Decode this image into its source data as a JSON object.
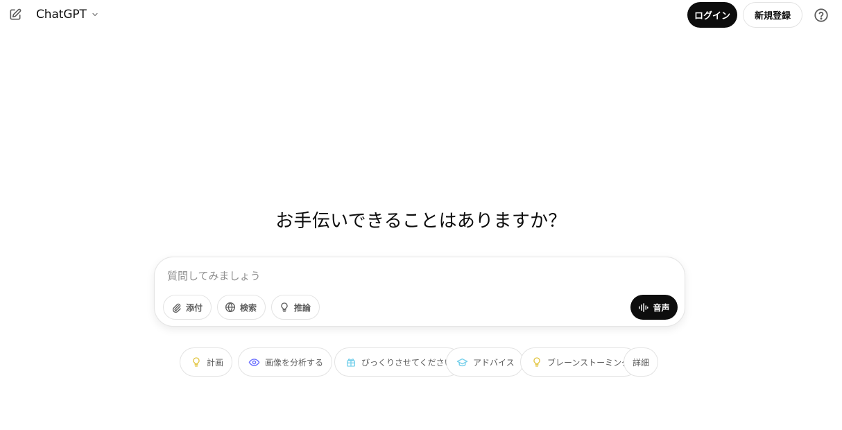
{
  "header": {
    "model_name": "ChatGPT",
    "login_label": "ログイン",
    "signup_label": "新規登録"
  },
  "main": {
    "heading": "お手伝いできることはありますか？"
  },
  "composer": {
    "placeholder": "質問してみましょう",
    "value": "",
    "tools": [
      {
        "label": "添付",
        "icon": "paperclip-icon"
      },
      {
        "label": "検索",
        "icon": "globe-icon"
      },
      {
        "label": "推論",
        "icon": "lightbulb-icon"
      }
    ],
    "voice_label": "音声"
  },
  "suggestions": [
    {
      "label": "計画",
      "icon": "lightbulb-icon",
      "color": "#e2c541"
    },
    {
      "label": "画像を分析する",
      "icon": "eye-icon",
      "color": "#6c71ff"
    },
    {
      "label": "びっくりさせてください",
      "icon": "gift-icon",
      "color": "#76d0eb"
    },
    {
      "label": "アドバイス",
      "icon": "graduation-cap-icon",
      "color": "#76d0eb"
    },
    {
      "label": "ブレーンストーミング",
      "icon": "lightbulb-icon",
      "color": "#e2c541"
    },
    {
      "label": "詳細",
      "icon": "",
      "color": ""
    }
  ],
  "colors": {
    "primary_button": "#0d0d0d",
    "border": "#e3e3e3",
    "muted_text": "#5d5d5d"
  }
}
